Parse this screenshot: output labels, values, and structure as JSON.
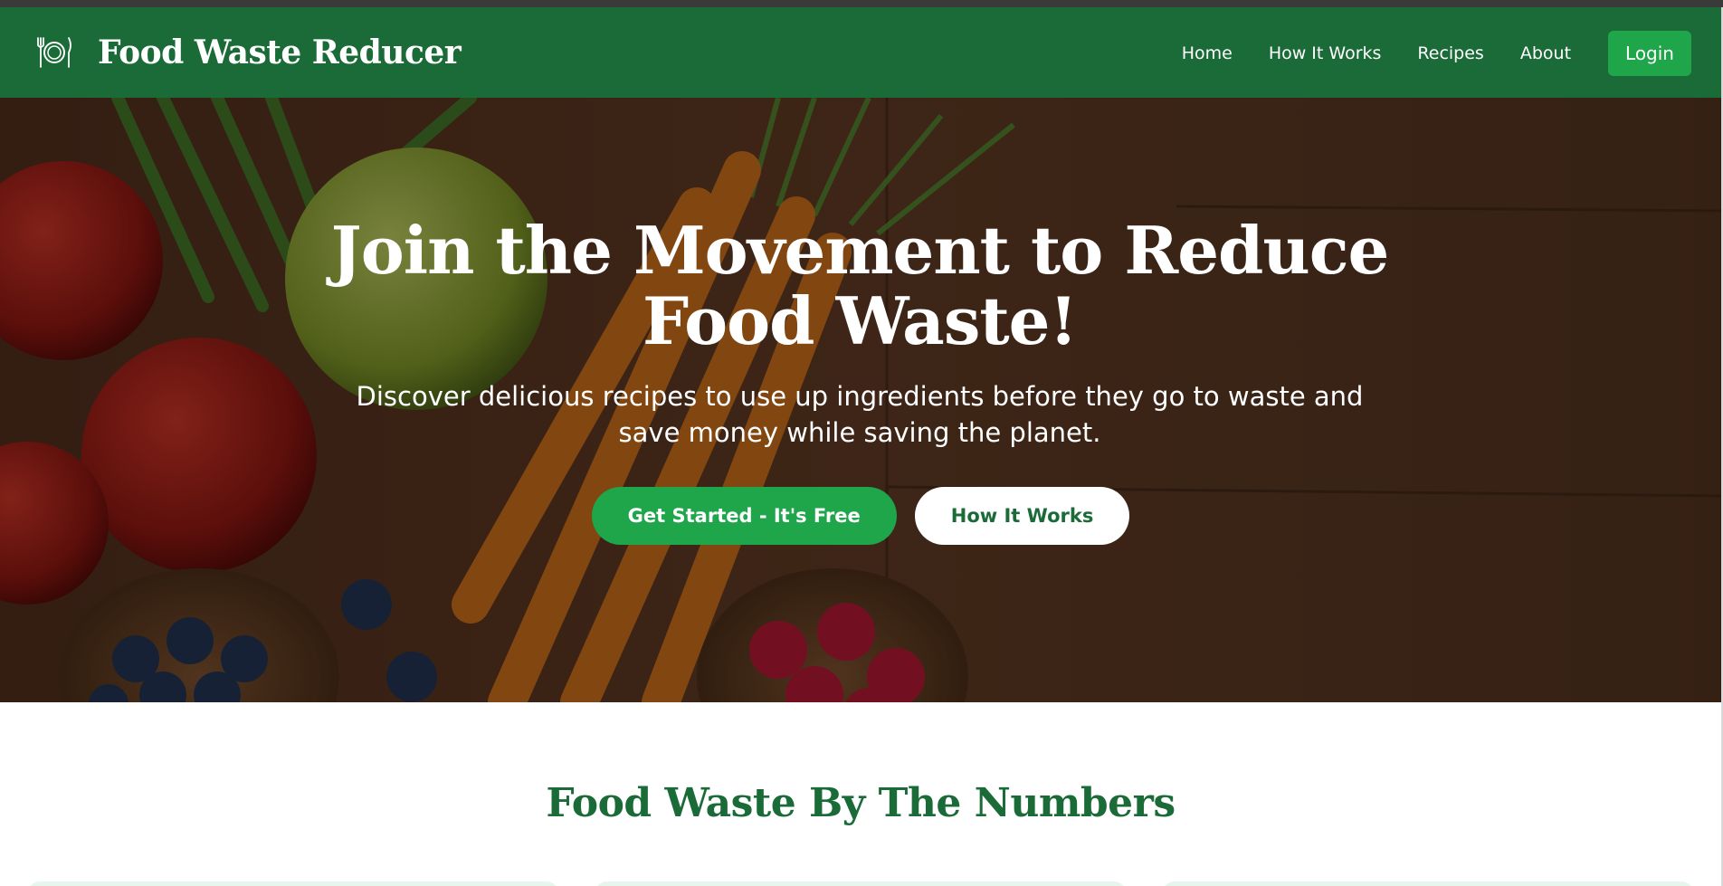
{
  "colors": {
    "brand_green": "#1a6b37",
    "accent_green": "#1fa54a",
    "white": "#ffffff"
  },
  "brand": {
    "icon": "utensils-plate-icon",
    "name": "Food Waste Reducer"
  },
  "nav": {
    "items": [
      {
        "label": "Home"
      },
      {
        "label": "How It Works"
      },
      {
        "label": "Recipes"
      },
      {
        "label": "About"
      }
    ],
    "login_label": "Login"
  },
  "hero": {
    "title": "Join the Movement to Reduce Food Waste!",
    "subtitle": "Discover delicious recipes to use up ingredients before they go to waste and save money while saving the planet.",
    "primary_button": "Get Started - It's Free",
    "secondary_button": "How It Works"
  },
  "numbers": {
    "title": "Food Waste By The Numbers",
    "card_count": 3
  }
}
